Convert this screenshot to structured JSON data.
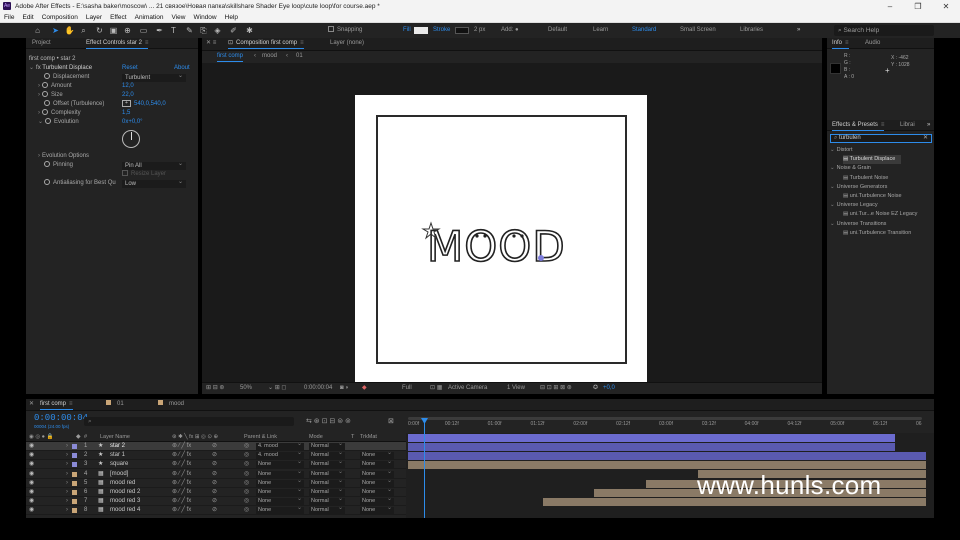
{
  "window": {
    "title": "Adobe After Effects - E:\\sasha baker\\moscow\\ ... 21 связое\\Новая папка\\skillshare Shader Eye loop\\cute loop\\for course.aep *",
    "app_icon": "Ae",
    "minimize": "–",
    "maximize": "❐",
    "close": "✕"
  },
  "menu": [
    "File",
    "Edit",
    "Composition",
    "Layer",
    "Effect",
    "Animation",
    "View",
    "Window",
    "Help"
  ],
  "toolbar": {
    "snapping": "Snapping",
    "fill": "Fill",
    "stroke": "Stroke",
    "stroke_width": "2 px",
    "add": "Add:",
    "workspaces": [
      "Default",
      "Learn",
      "Standard",
      "Small Screen",
      "Libraries"
    ],
    "active_workspace": "Standard",
    "more": "»",
    "search_placeholder": "Search Help"
  },
  "left_panel": {
    "tab_project": "Project",
    "tab_effect_controls": "Effect Controls star 2",
    "breadcrumb": "first comp • star 2",
    "effect_name": "Turbulent Displace",
    "reset": "Reset",
    "about": "About",
    "props": [
      {
        "label": "Displacement",
        "value": "Turbulent",
        "kind": "dropdown"
      },
      {
        "label": "Amount",
        "value": "12,0",
        "kind": "number"
      },
      {
        "label": "Size",
        "value": "22,0",
        "kind": "number"
      },
      {
        "label": "Offset (Turbulence)",
        "value": "540,0,540,0",
        "kind": "point"
      },
      {
        "label": "Complexity",
        "value": "1,5",
        "kind": "number"
      },
      {
        "label": "Evolution",
        "value": "0x+0,0°",
        "kind": "number"
      }
    ],
    "evolution_options": "Evolution Options",
    "pinning_label": "Pinning",
    "pinning_value": "Pin All",
    "resize_layer": "Resize Layer",
    "antialias_label": "Antialiasing for Best Qu",
    "antialias_value": "Low"
  },
  "comp_panel": {
    "tab_composition": "Composition first comp",
    "tab_layer": "Layer (none)",
    "flow_tabs": [
      "first comp",
      "mood",
      "01"
    ],
    "artwork_text": "MOOD",
    "viewer": {
      "zoom": "50%",
      "timecode": "0:00:00:04",
      "resolution": "Full",
      "camera": "Active Camera",
      "views": "1 View",
      "exposure": "+0,0"
    }
  },
  "right_panel": {
    "info_tab": "Info",
    "audio_tab": "Audio",
    "info": {
      "r": "R :",
      "g": "G :",
      "b": "B :",
      "a": "A : 0",
      "x": "X : -462",
      "y": "Y : 1028"
    },
    "effects_tab": "Effects & Presets",
    "libraries_tab": "Librai",
    "search_value": "turbulen",
    "tree": [
      {
        "type": "category",
        "label": "Distort"
      },
      {
        "type": "item",
        "label": "Turbulent Displace",
        "selected": true
      },
      {
        "type": "category",
        "label": "Noise & Grain"
      },
      {
        "type": "item",
        "label": "Turbulent Noise",
        "selected": false
      },
      {
        "type": "category",
        "label": "Universe Generators"
      },
      {
        "type": "item",
        "label": "uni.Turbulence Noise",
        "selected": false
      },
      {
        "type": "category",
        "label": "Universe Legacy"
      },
      {
        "type": "item",
        "label": "uni.Tur...e Noise EZ Legacy",
        "selected": false
      },
      {
        "type": "category",
        "label": "Universe Transitions"
      },
      {
        "type": "item",
        "label": "uni.Turbulence Transition",
        "selected": false
      }
    ]
  },
  "timeline": {
    "tabs": [
      "first comp",
      "01",
      "mood"
    ],
    "active_tab": "first comp",
    "timecode": "0:00:00:04",
    "timecode_sub": "00004 (24.00 fps)",
    "search_placeholder": "⌕",
    "columns": {
      "num": "#",
      "layer_name": "Layer Name",
      "parent": "Parent & Link",
      "mode": "Mode",
      "t": "T",
      "trkmat": "TrkMat"
    },
    "ruler": [
      "0:00f",
      "00:12f",
      "01:00f",
      "01:12f",
      "02:00f",
      "02:12f",
      "03:00f",
      "03:12f",
      "04:00f",
      "04:12f",
      "05:00f",
      "05:12f",
      "06"
    ],
    "layers": [
      {
        "num": "1",
        "name": "star 2",
        "icon": "★",
        "color": "#8a8ad6",
        "parent": "4. mood",
        "mode": "Normal",
        "trkmat": "",
        "selected": true,
        "start": 0.0,
        "end": 0.94
      },
      {
        "num": "2",
        "name": "star 1",
        "icon": "★",
        "color": "#8a8ad6",
        "parent": "4. mood",
        "mode": "Normal",
        "trkmat": "None",
        "selected": false,
        "start": 0.0,
        "end": 0.94
      },
      {
        "num": "3",
        "name": "square",
        "icon": "★",
        "color": "#8a8ad6",
        "parent": "None",
        "mode": "Normal",
        "trkmat": "None",
        "selected": false,
        "start": 0.0,
        "end": 1.0
      },
      {
        "num": "4",
        "name": "[mood]",
        "icon": "▦",
        "color": "#c9a577",
        "parent": "None",
        "mode": "Normal",
        "trkmat": "None",
        "selected": false,
        "start": 0.0,
        "end": 1.0
      },
      {
        "num": "5",
        "name": "mood red",
        "icon": "▦",
        "color": "#c9a577",
        "parent": "None",
        "mode": "Normal",
        "trkmat": "None",
        "selected": false,
        "start": 0.56,
        "end": 1.0
      },
      {
        "num": "6",
        "name": "mood red 2",
        "icon": "▦",
        "color": "#c9a577",
        "parent": "None",
        "mode": "Normal",
        "trkmat": "None",
        "selected": false,
        "start": 0.46,
        "end": 1.0
      },
      {
        "num": "7",
        "name": "mood red 3",
        "icon": "▦",
        "color": "#c9a577",
        "parent": "None",
        "mode": "Normal",
        "trkmat": "None",
        "selected": false,
        "start": 0.36,
        "end": 1.0
      },
      {
        "num": "8",
        "name": "mood red 4",
        "icon": "▦",
        "color": "#c9a577",
        "parent": "None",
        "mode": "Normal",
        "trkmat": "None",
        "selected": false,
        "start": 0.26,
        "end": 1.0
      }
    ]
  },
  "watermark": "www.hunls.com",
  "colors": {
    "accent": "#2d8ceb",
    "panel": "#232323",
    "shape_label": "#8a8ad6",
    "precomp_label": "#c9a577"
  }
}
